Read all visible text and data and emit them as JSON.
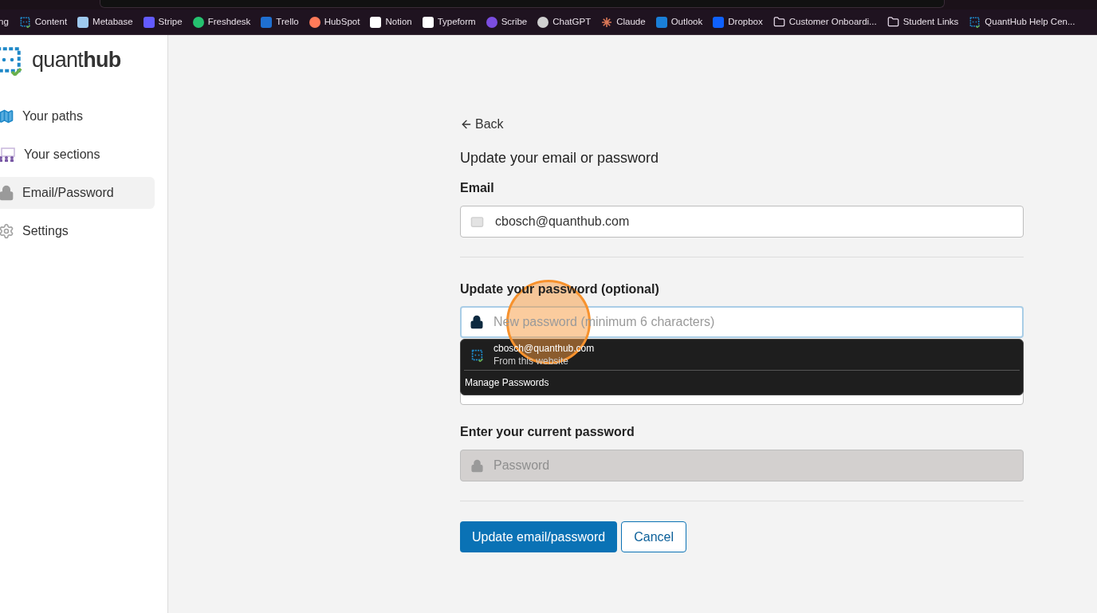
{
  "bookmarks": [
    {
      "label": "ng",
      "kind": "cut"
    },
    {
      "label": "Content",
      "kind": "chip"
    },
    {
      "label": "Metabase",
      "kind": "site",
      "color": "#9ec9ee"
    },
    {
      "label": "Stripe",
      "kind": "site",
      "color": "#635bff"
    },
    {
      "label": "Freshdesk",
      "kind": "round",
      "color": "#25c16f"
    },
    {
      "label": "Trello",
      "kind": "site",
      "color": "#1f6fd1"
    },
    {
      "label": "HubSpot",
      "kind": "round",
      "color": "#ff7a59"
    },
    {
      "label": "Notion",
      "kind": "site",
      "color": "#ffffff"
    },
    {
      "label": "Typeform",
      "kind": "site",
      "color": "#ffffff"
    },
    {
      "label": "Scribe",
      "kind": "round",
      "color": "#7b4de0"
    },
    {
      "label": "ChatGPT",
      "kind": "round",
      "color": "#d0d0d0"
    },
    {
      "label": "Claude",
      "kind": "star",
      "color": "#d97757"
    },
    {
      "label": "Outlook",
      "kind": "site",
      "color": "#1a7fd8"
    },
    {
      "label": "Dropbox",
      "kind": "site",
      "color": "#0f61fe"
    },
    {
      "label": "Customer Onboardi...",
      "kind": "folder"
    },
    {
      "label": "Student Links",
      "kind": "folder"
    },
    {
      "label": "QuantHub Help Cen...",
      "kind": "chip"
    }
  ],
  "logo": {
    "light": "quant",
    "bold": "hub"
  },
  "nav": [
    {
      "label": "Your paths",
      "kind": "map",
      "selected": false
    },
    {
      "label": "Your sections",
      "kind": "people",
      "selected": false
    },
    {
      "label": "Email/Password",
      "kind": "lock",
      "selected": true
    },
    {
      "label": "Settings",
      "kind": "gear",
      "selected": false
    }
  ],
  "back": "Back",
  "title": "Update your email or password",
  "email": {
    "label": "Email",
    "value": "cbosch@quanthub.com"
  },
  "new_password": {
    "label": "Update your password (optional)",
    "placeholder": "New password (minimum 6 characters)"
  },
  "autofill": {
    "account": "cbosch@quanthub.com",
    "source": "From this website",
    "manage": "Manage Passwords"
  },
  "current_password": {
    "label": "Enter your current password",
    "placeholder": "Password",
    "disabled": true
  },
  "buttons": [
    {
      "label": "Update email/password",
      "kind": "primary"
    },
    {
      "label": "Cancel",
      "kind": "secondary"
    }
  ]
}
